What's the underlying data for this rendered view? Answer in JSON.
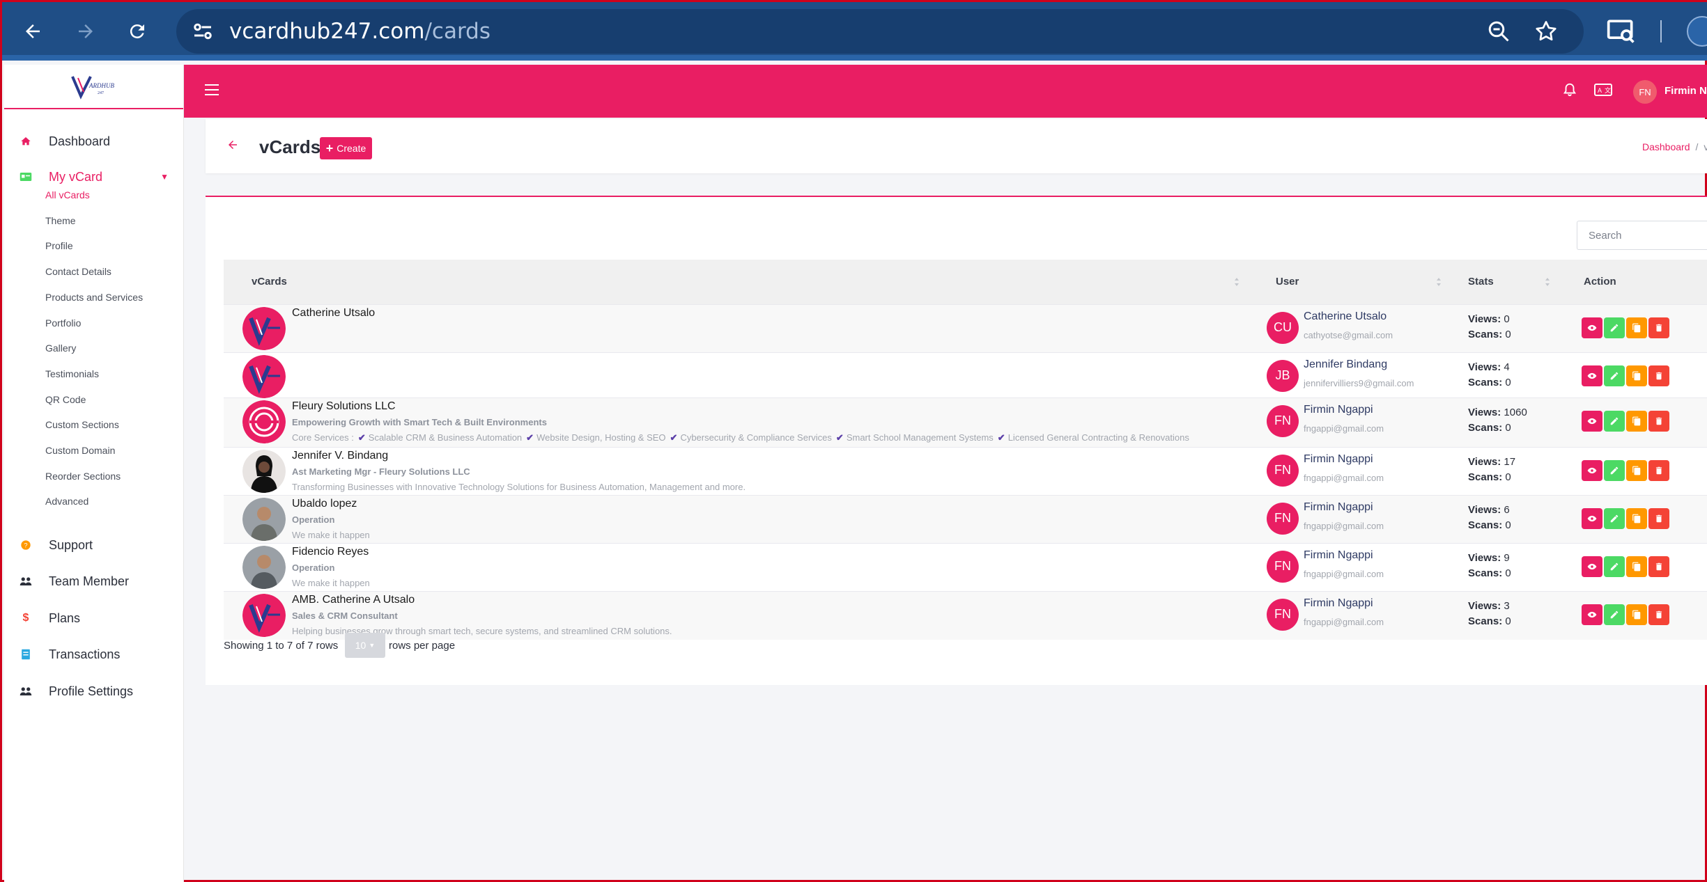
{
  "browser": {
    "domain": "vcardhub247.com",
    "path": "/cards"
  },
  "sidebar": {
    "brand": "VCardHub",
    "items": [
      {
        "label": "Dashboard",
        "icon": "home-icon"
      },
      {
        "label": "My vCard",
        "icon": "id-card-icon"
      },
      {
        "label": "Support",
        "icon": "question-icon"
      },
      {
        "label": "Team Member",
        "icon": "users-icon"
      },
      {
        "label": "Plans",
        "icon": "dollar-icon"
      },
      {
        "label": "Transactions",
        "icon": "receipt-icon"
      },
      {
        "label": "Profile Settings",
        "icon": "users-cog-icon"
      }
    ],
    "submenu": [
      "All vCards",
      "Theme",
      "Profile",
      "Contact Details",
      "Products and Services",
      "Portfolio",
      "Gallery",
      "Testimonials",
      "QR Code",
      "Custom Sections",
      "Custom Domain",
      "Reorder Sections",
      "Advanced"
    ]
  },
  "topbar": {
    "user_initials": "FN",
    "user_name": "Firmin Ngappi"
  },
  "page": {
    "title": "vCards",
    "create_label": "Create",
    "breadcrumb_home": "Dashboard",
    "breadcrumb_current": "vCards"
  },
  "search": {
    "placeholder": "Search"
  },
  "table": {
    "headers": {
      "vcards": "vCards",
      "user": "User",
      "stats": "Stats",
      "action": "Action"
    },
    "views_label": "Views:",
    "scans_label": "Scans:",
    "rows": [
      {
        "name": "Catherine Utsalo",
        "occupation": "",
        "description": "",
        "user_initials": "CU",
        "user_name": "Catherine Utsalo",
        "user_email": "cathyotse@gmail.com",
        "views": "0",
        "scans": "0"
      },
      {
        "name": "",
        "occupation": "",
        "description": "",
        "user_initials": "JB",
        "user_name": "Jennifer Bindang",
        "user_email": "jennifervilliers9@gmail.com",
        "views": "4",
        "scans": "0"
      },
      {
        "name": "Fleury Solutions LLC",
        "occupation": "Empowering Growth with Smart Tech & Built Environments",
        "description": "Core Services :",
        "services": [
          "Scalable CRM & Business Automation",
          "Website Design, Hosting & SEO",
          "Cybersecurity & Compliance Services",
          "Smart School Management Systems",
          "Licensed General Contracting & Renovations"
        ],
        "user_initials": "FN",
        "user_name": "Firmin Ngappi",
        "user_email": "fngappi@gmail.com",
        "views": "1060",
        "scans": "0"
      },
      {
        "name": "Jennifer V. Bindang",
        "occupation": "Ast Marketing Mgr - Fleury Solutions LLC",
        "description": "Transforming Businesses with Innovative Technology Solutions for Business Automation, Management and more.",
        "user_initials": "FN",
        "user_name": "Firmin Ngappi",
        "user_email": "fngappi@gmail.com",
        "views": "17",
        "scans": "0"
      },
      {
        "name": "Ubaldo lopez",
        "occupation": "Operation",
        "description": "We make it happen",
        "user_initials": "FN",
        "user_name": "Firmin Ngappi",
        "user_email": "fngappi@gmail.com",
        "views": "6",
        "scans": "0"
      },
      {
        "name": "Fidencio Reyes",
        "occupation": "Operation",
        "description": "We make it happen",
        "user_initials": "FN",
        "user_name": "Firmin Ngappi",
        "user_email": "fngappi@gmail.com",
        "views": "9",
        "scans": "0"
      },
      {
        "name": "AMB. Catherine A Utsalo",
        "occupation": "Sales & CRM Consultant",
        "description": "Helping businesses grow through smart tech, secure systems, and streamlined CRM solutions.",
        "user_initials": "FN",
        "user_name": "Firmin Ngappi",
        "user_email": "fngappi@gmail.com",
        "views": "3",
        "scans": "0"
      }
    ]
  },
  "pagination": {
    "info": "Showing 1 to 7 of 7 rows",
    "page_size": "10",
    "rows_per_page": "rows per page"
  },
  "colors": {
    "accent": "#e91e63",
    "view": "#e91e63",
    "edit": "#4cd964",
    "copy": "#ff9800",
    "delete": "#f44336"
  }
}
